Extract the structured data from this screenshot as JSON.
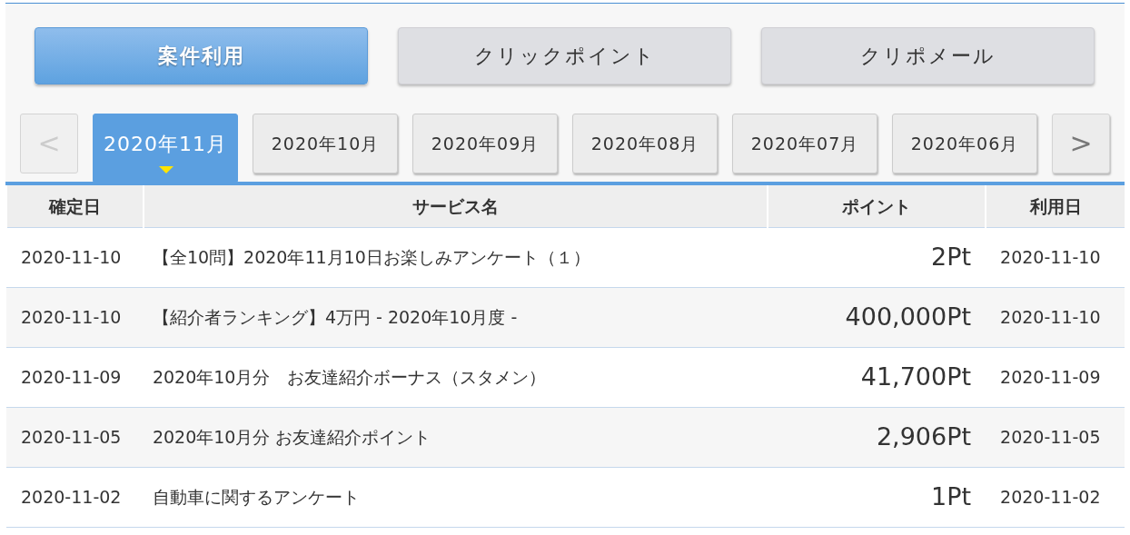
{
  "categories": [
    {
      "label": "案件利用",
      "selected": true
    },
    {
      "label": "クリックポイント",
      "selected": false
    },
    {
      "label": "クリポメール",
      "selected": false
    }
  ],
  "month_nav": {
    "prev": {
      "label": "<",
      "disabled": true
    },
    "next": {
      "label": ">",
      "disabled": false
    }
  },
  "months": [
    {
      "label": "2020年11月",
      "selected": true
    },
    {
      "label": "2020年10月",
      "selected": false
    },
    {
      "label": "2020年09月",
      "selected": false
    },
    {
      "label": "2020年08月",
      "selected": false
    },
    {
      "label": "2020年07月",
      "selected": false
    },
    {
      "label": "2020年06月",
      "selected": false
    }
  ],
  "table": {
    "columns": [
      "確定日",
      "サービス名",
      "ポイント",
      "利用日"
    ],
    "rows": [
      {
        "confirmed": "2020-11-10",
        "service": "【全10問】2020年11月10日お楽しみアンケート（１）",
        "points": "2Pt",
        "used": "2020-11-10"
      },
      {
        "confirmed": "2020-11-10",
        "service": "【紹介者ランキング】4万円 - 2020年10月度 -",
        "points": "400,000Pt",
        "used": "2020-11-10"
      },
      {
        "confirmed": "2020-11-09",
        "service": "2020年10月分　お友達紹介ボーナス（スタメン）",
        "points": "41,700Pt",
        "used": "2020-11-09"
      },
      {
        "confirmed": "2020-11-05",
        "service": "2020年10月分 お友達紹介ポイント",
        "points": "2,906Pt",
        "used": "2020-11-05"
      },
      {
        "confirmed": "2020-11-02",
        "service": "自動車に関するアンケート",
        "points": "1Pt",
        "used": "2020-11-02"
      }
    ]
  }
}
